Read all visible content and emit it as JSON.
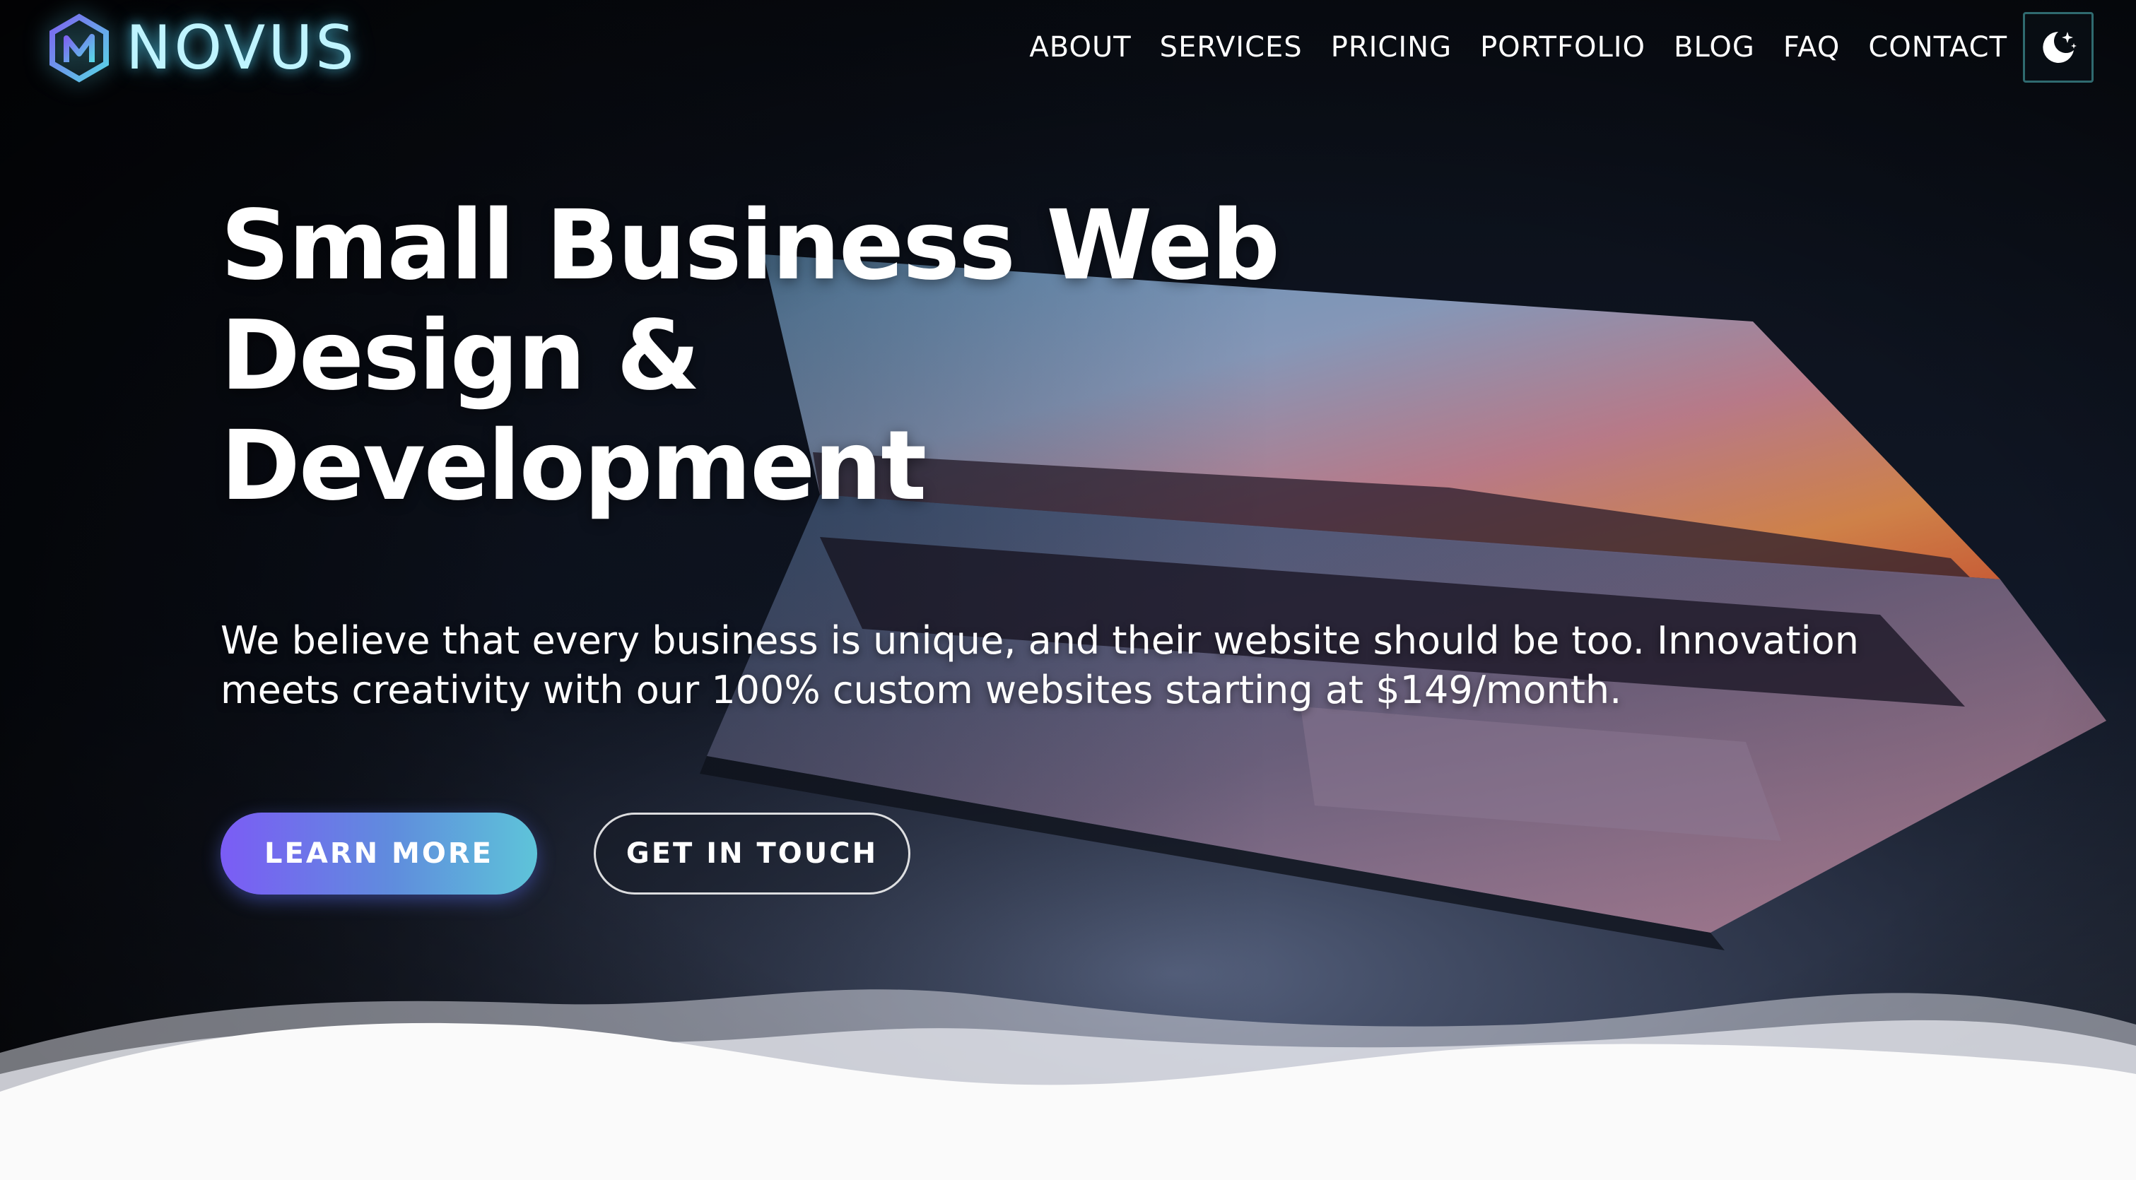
{
  "brand": {
    "name": "NOVUS",
    "logo_icon": "novus-hex-logo-icon",
    "glow_color": "#6ae8ff"
  },
  "nav": {
    "items": [
      {
        "label": "ABOUT"
      },
      {
        "label": "SERVICES"
      },
      {
        "label": "PRICING"
      },
      {
        "label": "PORTFOLIO"
      },
      {
        "label": "BLOG"
      },
      {
        "label": "FAQ"
      },
      {
        "label": "CONTACT"
      }
    ],
    "theme_toggle_icon": "moon-stars-icon",
    "toggle_border_color": "#2f6a6f"
  },
  "hero": {
    "title": "Small Business Web Design & Development",
    "subtitle": "We believe that every business is unique, and their website should be too. Innovation meets creativity with our 100% custom websites starting at $149/month.",
    "background_image": "laptop-hero-image",
    "buttons": {
      "learn_more": "LEARN MORE",
      "get_in_touch": "GET IN TOUCH"
    },
    "accent_gradient": [
      "#7b5cf5",
      "#5ec4d9"
    ]
  },
  "footer_wave": {
    "fill_color": "#fafafa"
  }
}
